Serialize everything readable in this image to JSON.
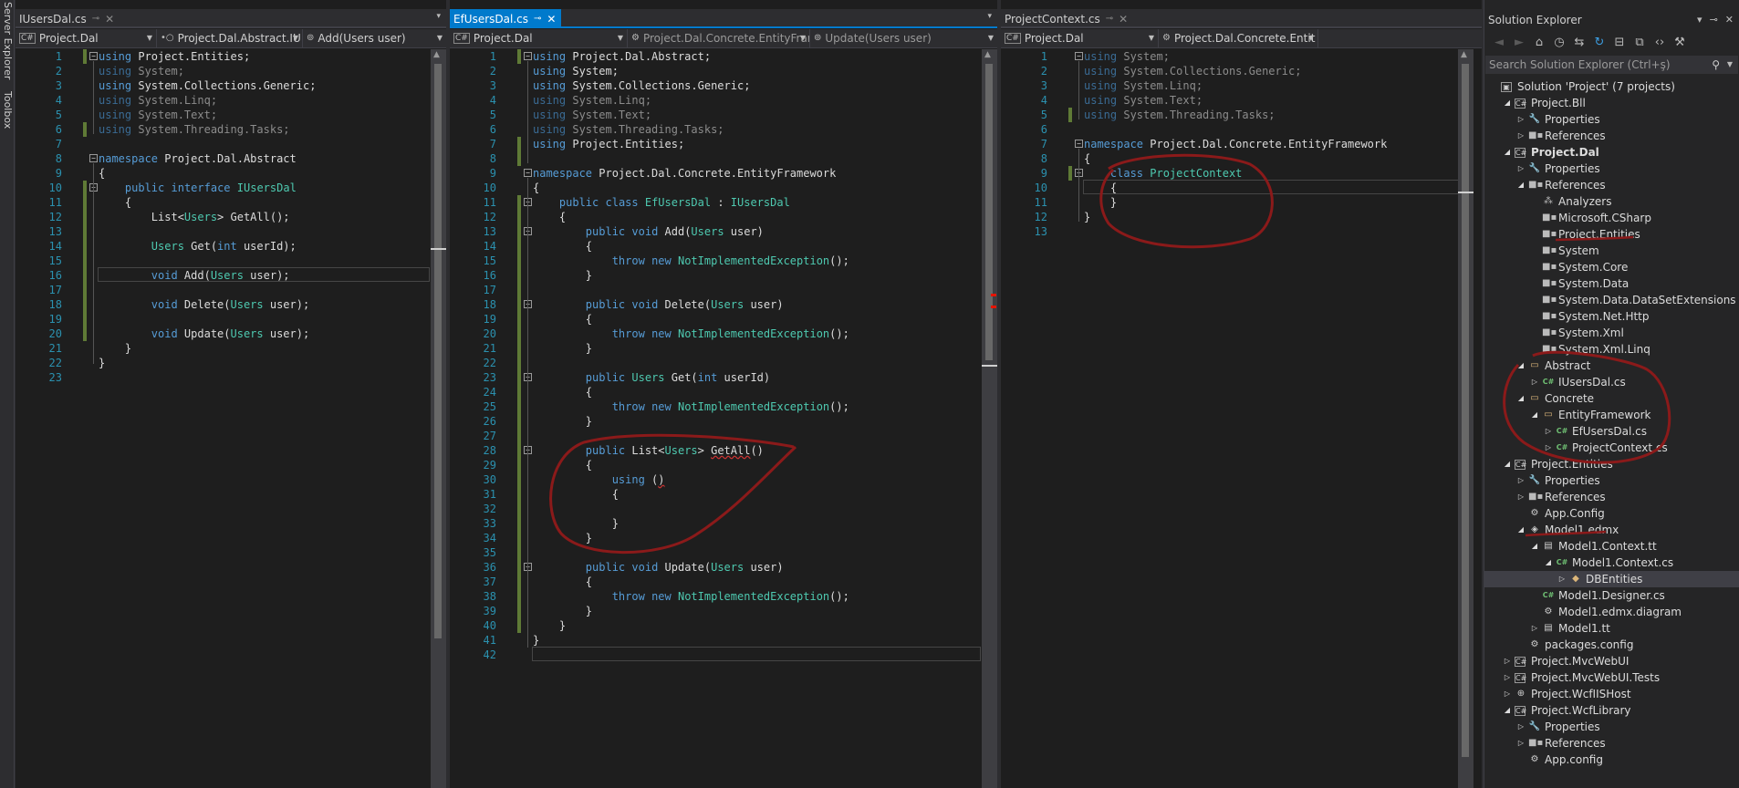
{
  "side_tabs": {
    "server_explorer": "Server Explorer",
    "toolbox": "Toolbox"
  },
  "pane1": {
    "tab": "IUsersDal.cs",
    "nav_project": "Project.Dal",
    "nav_type": "Project.Dal.Abstract.IU",
    "nav_member": "Add(Users user)"
  },
  "pane2": {
    "tab": "EfUsersDal.cs",
    "nav_project": "Project.Dal",
    "nav_type": "Project.Dal.Concrete.EntityFrar",
    "nav_member": "Update(Users user)"
  },
  "pane3": {
    "tab": "ProjectContext.cs",
    "nav_project": "Project.Dal",
    "nav_type": "Project.Dal.Concrete.Entit"
  },
  "solution_explorer": {
    "title": "Solution Explorer",
    "search_placeholder": "Search Solution Explorer (Ctrl+ş)",
    "tree": [
      {
        "label": "Solution 'Project' (7 projects)",
        "level": 0,
        "toggle": "",
        "icon": "solution"
      },
      {
        "label": "Project.Bll",
        "level": 1,
        "toggle": "open",
        "icon": "proj"
      },
      {
        "label": "Properties",
        "level": 2,
        "toggle": "closed",
        "icon": "wrench"
      },
      {
        "label": "References",
        "level": 2,
        "toggle": "closed",
        "icon": "ref"
      },
      {
        "label": "Project.Dal",
        "level": 1,
        "toggle": "open",
        "icon": "proj",
        "bold": true
      },
      {
        "label": "Properties",
        "level": 2,
        "toggle": "closed",
        "icon": "wrench"
      },
      {
        "label": "References",
        "level": 2,
        "toggle": "open",
        "icon": "ref"
      },
      {
        "label": "Analyzers",
        "level": 3,
        "toggle": "",
        "icon": "analyzer"
      },
      {
        "label": "Microsoft.CSharp",
        "level": 3,
        "toggle": "",
        "icon": "ref"
      },
      {
        "label": "Project.Entities",
        "level": 3,
        "toggle": "",
        "icon": "ref"
      },
      {
        "label": "System",
        "level": 3,
        "toggle": "",
        "icon": "ref"
      },
      {
        "label": "System.Core",
        "level": 3,
        "toggle": "",
        "icon": "ref"
      },
      {
        "label": "System.Data",
        "level": 3,
        "toggle": "",
        "icon": "ref"
      },
      {
        "label": "System.Data.DataSetExtensions",
        "level": 3,
        "toggle": "",
        "icon": "ref"
      },
      {
        "label": "System.Net.Http",
        "level": 3,
        "toggle": "",
        "icon": "ref"
      },
      {
        "label": "System.Xml",
        "level": 3,
        "toggle": "",
        "icon": "ref"
      },
      {
        "label": "System.Xml.Linq",
        "level": 3,
        "toggle": "",
        "icon": "ref"
      },
      {
        "label": "Abstract",
        "level": 2,
        "toggle": "open",
        "icon": "folder"
      },
      {
        "label": "IUsersDal.cs",
        "level": 3,
        "toggle": "closed",
        "icon": "cs"
      },
      {
        "label": "Concrete",
        "level": 2,
        "toggle": "open",
        "icon": "folder"
      },
      {
        "label": "EntityFramework",
        "level": 3,
        "toggle": "open",
        "icon": "folder"
      },
      {
        "label": "EfUsersDal.cs",
        "level": 4,
        "toggle": "closed",
        "icon": "cs"
      },
      {
        "label": "ProjectContext.cs",
        "level": 4,
        "toggle": "closed",
        "icon": "cs"
      },
      {
        "label": "Project.Entities",
        "level": 1,
        "toggle": "open",
        "icon": "proj"
      },
      {
        "label": "Properties",
        "level": 2,
        "toggle": "closed",
        "icon": "wrench"
      },
      {
        "label": "References",
        "level": 2,
        "toggle": "closed",
        "icon": "ref"
      },
      {
        "label": "App.Config",
        "level": 2,
        "toggle": "",
        "icon": "cfg"
      },
      {
        "label": "Model1.edmx",
        "level": 2,
        "toggle": "open",
        "icon": "edmx"
      },
      {
        "label": "Model1.Context.tt",
        "level": 3,
        "toggle": "open",
        "icon": "tt"
      },
      {
        "label": "Model1.Context.cs",
        "level": 4,
        "toggle": "open",
        "icon": "cs"
      },
      {
        "label": "DBEntities",
        "level": 5,
        "toggle": "closed",
        "icon": "entity",
        "selected": true
      },
      {
        "label": "Model1.Designer.cs",
        "level": 3,
        "toggle": "",
        "icon": "cs"
      },
      {
        "label": "Model1.edmx.diagram",
        "level": 3,
        "toggle": "",
        "icon": "cfg"
      },
      {
        "label": "Model1.tt",
        "level": 3,
        "toggle": "closed",
        "icon": "tt"
      },
      {
        "label": "packages.config",
        "level": 2,
        "toggle": "",
        "icon": "cfg"
      },
      {
        "label": "Project.MvcWebUI",
        "level": 1,
        "toggle": "closed",
        "icon": "proj"
      },
      {
        "label": "Project.MvcWebUI.Tests",
        "level": 1,
        "toggle": "closed",
        "icon": "proj"
      },
      {
        "label": "Project.WcfIISHost",
        "level": 1,
        "toggle": "closed",
        "icon": "web"
      },
      {
        "label": "Project.WcfLibrary",
        "level": 1,
        "toggle": "open",
        "icon": "proj"
      },
      {
        "label": "Properties",
        "level": 2,
        "toggle": "closed",
        "icon": "wrench"
      },
      {
        "label": "References",
        "level": 2,
        "toggle": "closed",
        "icon": "ref"
      },
      {
        "label": "App.config",
        "level": 2,
        "toggle": "",
        "icon": "cfg"
      }
    ]
  }
}
